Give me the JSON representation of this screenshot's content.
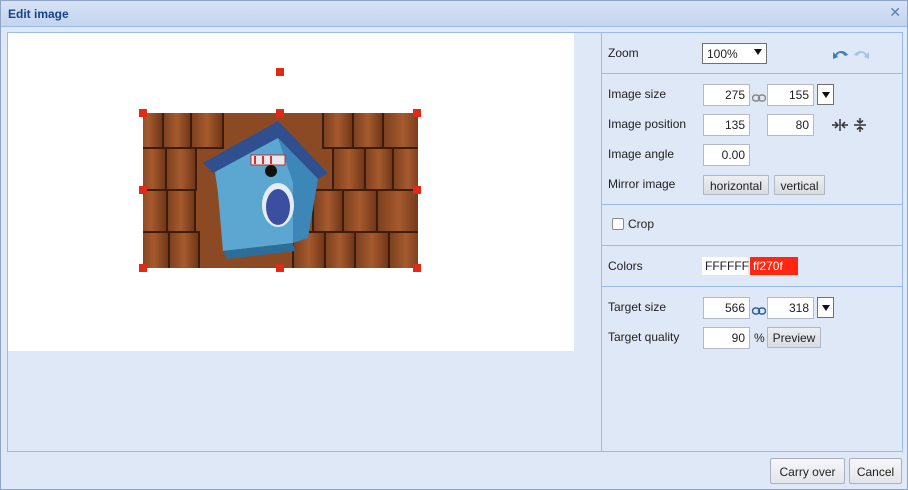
{
  "dialog": {
    "title": "Edit image",
    "close_icon": "close-icon"
  },
  "zoom": {
    "label": "Zoom",
    "value": "100%"
  },
  "image_size": {
    "label": "Image size",
    "width": "275",
    "height": "155"
  },
  "image_position": {
    "label": "Image position",
    "x": "135",
    "y": "80"
  },
  "image_angle": {
    "label": "Image angle",
    "value": "0.00"
  },
  "mirror": {
    "label": "Mirror image",
    "horizontal": "horizontal",
    "vertical": "vertical"
  },
  "crop": {
    "label": "Crop",
    "checked": false
  },
  "colors": {
    "label": "Colors",
    "background": "FFFFFF",
    "handle": "ff270f"
  },
  "target_size": {
    "label": "Target size",
    "width": "566",
    "height": "318"
  },
  "target_quality": {
    "label": "Target quality",
    "value": "90",
    "unit": "%",
    "preview": "Preview"
  },
  "footer": {
    "carry_over": "Carry over",
    "cancel": "Cancel"
  },
  "theme": {
    "accent": "#15428b",
    "handle_color": "#e22b16",
    "panel_bg": "#dfe8f6"
  }
}
